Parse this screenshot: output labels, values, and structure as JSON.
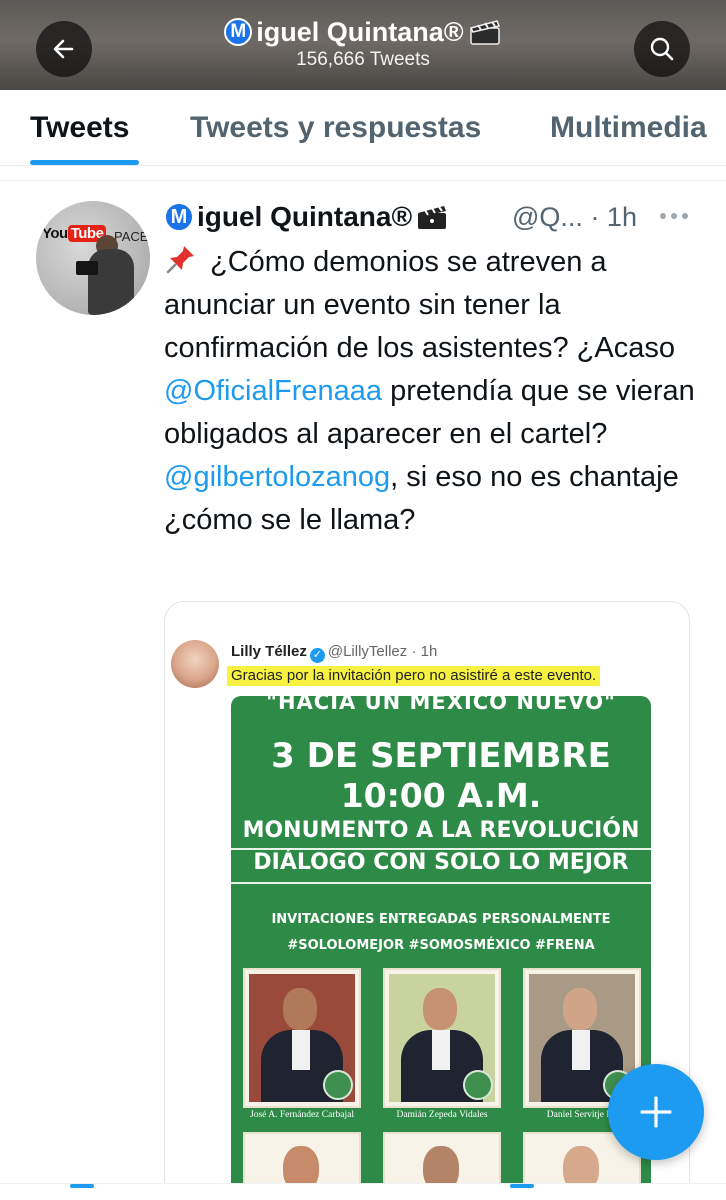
{
  "header": {
    "name_initial": "M",
    "name_rest": "iguel Quintana®",
    "tweet_count": "156,666 Tweets",
    "background_color": "#5d5a57"
  },
  "tabs": [
    {
      "label": "Tweets",
      "active": true
    },
    {
      "label": "Tweets y respuestas",
      "active": false
    },
    {
      "label": "Multimedia",
      "active": false
    }
  ],
  "tweet": {
    "author_initial": "M",
    "author_rest": "iguel Quintana®",
    "handle": "@Q...",
    "time": "· 1h",
    "text_parts": {
      "intro": "¿Cómo demonios se atreven a anunciar un evento sin tener la confirmación de los asistentes? ¿Acaso ",
      "mention1": "@OficialFrenaaa",
      "middle": " pretendía que se vieran obligados al aparecer en el cartel? ",
      "mention2": "@gilbertolozanog",
      "outro": ", si eso no es chantaje ¿cómo se le llama?"
    },
    "avatar_logo": "You",
    "avatar_logo_tube": "Tube",
    "avatar_logo_space": "PACE"
  },
  "embedded": {
    "name": "Lilly Téllez",
    "handle": "@LillyTellez · 1h",
    "text": "Gracias por la invitación pero no asistiré a este evento.",
    "poster": {
      "line1": "\"HACIA UN MÉXICO NUEVO\"",
      "line2": "3 DE SEPTIEMBRE",
      "line3": "10:00 A.M.",
      "line4": "MONUMENTO A LA REVOLUCIÓN",
      "line5": "DIÁLOGO CON SOLO LO MEJOR",
      "line6": "INVITACIONES ENTREGADAS PERSONALMENTE",
      "line7": "#SOLOLOMEJOR #SOMOSMÉXICO #FRENA",
      "captions": [
        "José A. Fernández Carbajal",
        "Damián Zepeda Vidales",
        "Daniel Servitje M."
      ]
    }
  },
  "icons": {
    "back": "arrow-left-icon",
    "search": "search-icon",
    "more": "more-horizontal-icon",
    "pin": "pushpin-icon",
    "compose": "plus-icon"
  },
  "colors": {
    "accent": "#1d9bf0",
    "poster_green": "#2e8b47",
    "highlight": "#f7f142"
  }
}
